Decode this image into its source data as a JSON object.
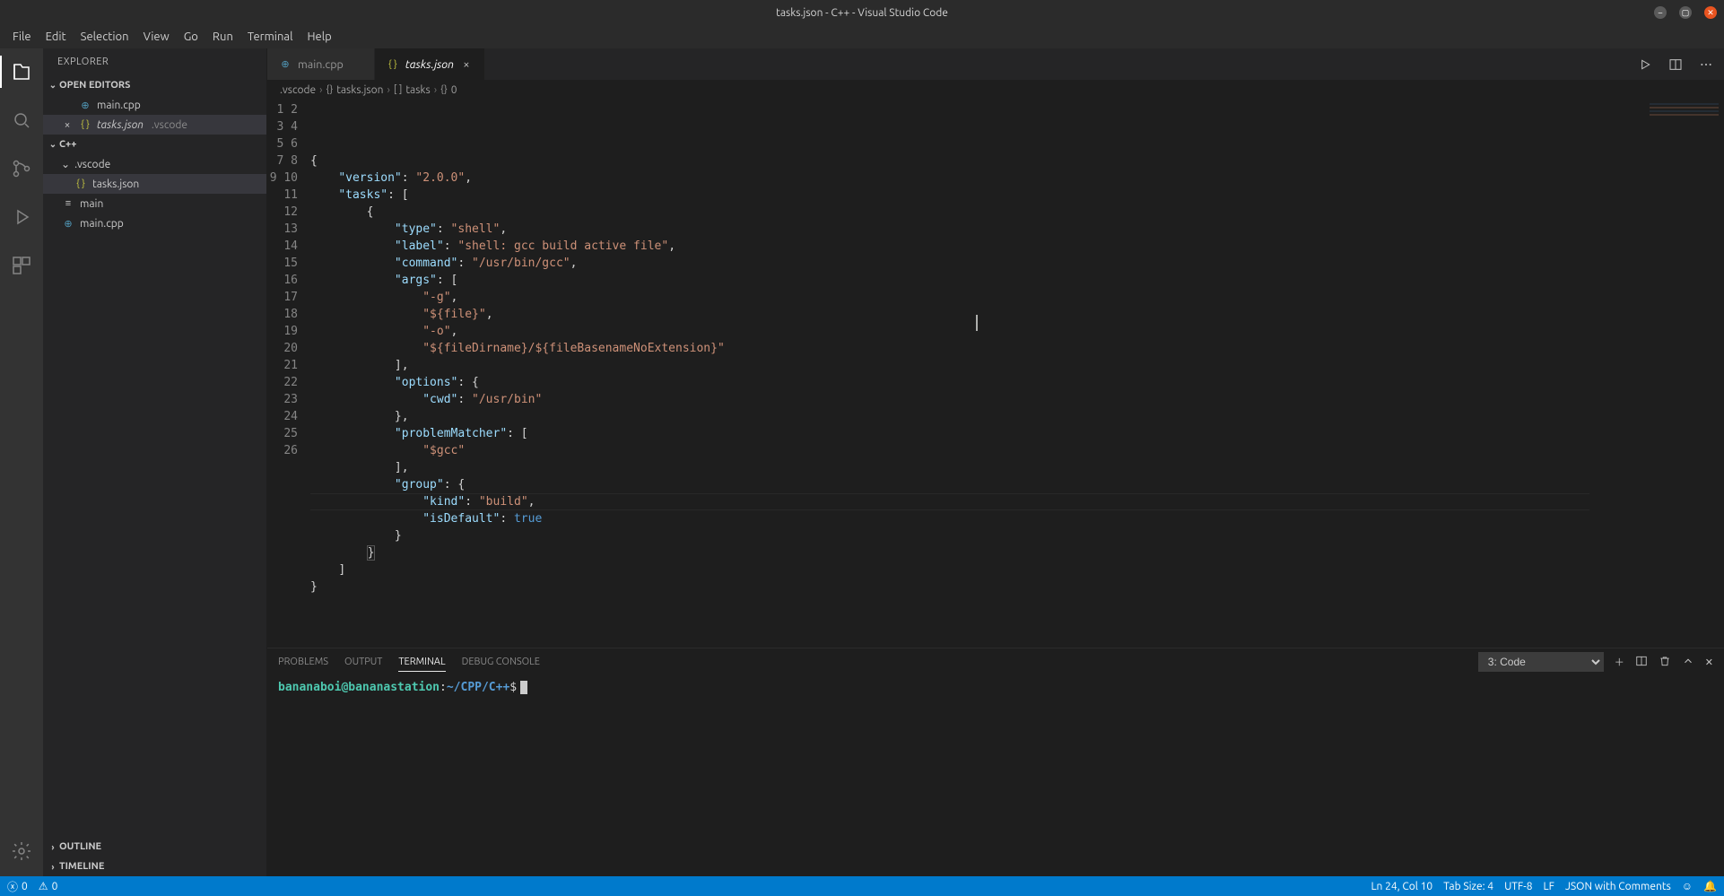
{
  "window": {
    "title": "tasks.json - C++ - Visual Studio Code"
  },
  "menu": {
    "items": [
      "File",
      "Edit",
      "Selection",
      "View",
      "Go",
      "Run",
      "Terminal",
      "Help"
    ]
  },
  "sidebar": {
    "title": "EXPLORER",
    "openEditors": {
      "label": "OPEN EDITORS",
      "items": [
        {
          "name": "main.cpp",
          "icon": "cpp",
          "dirty": false
        },
        {
          "name": "tasks.json",
          "icon": "json",
          "desc": ".vscode",
          "dirty": false,
          "active": true
        }
      ]
    },
    "workspace": {
      "label": "C++",
      "tree": [
        {
          "name": ".vscode",
          "type": "folder",
          "expanded": true,
          "indent": 1
        },
        {
          "name": "tasks.json",
          "type": "file",
          "icon": "json",
          "indent": 2,
          "selected": true
        },
        {
          "name": "main",
          "type": "file",
          "icon": "lines",
          "indent": 1
        },
        {
          "name": "main.cpp",
          "type": "file",
          "icon": "cpp",
          "indent": 1
        }
      ]
    },
    "outline": "OUTLINE",
    "timeline": "TIMELINE"
  },
  "tabs": [
    {
      "name": "main.cpp",
      "icon": "cpp",
      "active": false,
      "dirty": false
    },
    {
      "name": "tasks.json",
      "icon": "json",
      "active": true,
      "dirty": false
    }
  ],
  "breadcrumbs": [
    {
      "text": ".vscode"
    },
    {
      "icon": "{}",
      "text": "tasks.json"
    },
    {
      "icon": "[ ]",
      "text": "tasks"
    },
    {
      "icon": "{}",
      "text": "0"
    }
  ],
  "editor": {
    "lineCount": 26,
    "activeLine": 24,
    "cursorCol": 10,
    "lines": [
      [
        {
          "t": "punct",
          "v": "{"
        }
      ],
      [
        {
          "t": "pad",
          "v": "    "
        },
        {
          "t": "key",
          "v": "\"version\""
        },
        {
          "t": "punct",
          "v": ": "
        },
        {
          "t": "str",
          "v": "\"2.0.0\""
        },
        {
          "t": "punct",
          "v": ","
        }
      ],
      [
        {
          "t": "pad",
          "v": "    "
        },
        {
          "t": "key",
          "v": "\"tasks\""
        },
        {
          "t": "punct",
          "v": ": ["
        }
      ],
      [
        {
          "t": "pad",
          "v": "        "
        },
        {
          "t": "punct",
          "v": "{"
        }
      ],
      [
        {
          "t": "pad",
          "v": "            "
        },
        {
          "t": "key",
          "v": "\"type\""
        },
        {
          "t": "punct",
          "v": ": "
        },
        {
          "t": "str",
          "v": "\"shell\""
        },
        {
          "t": "punct",
          "v": ","
        }
      ],
      [
        {
          "t": "pad",
          "v": "            "
        },
        {
          "t": "key",
          "v": "\"label\""
        },
        {
          "t": "punct",
          "v": ": "
        },
        {
          "t": "str",
          "v": "\"shell: gcc build active file\""
        },
        {
          "t": "punct",
          "v": ","
        }
      ],
      [
        {
          "t": "pad",
          "v": "            "
        },
        {
          "t": "key",
          "v": "\"command\""
        },
        {
          "t": "punct",
          "v": ": "
        },
        {
          "t": "str",
          "v": "\"/usr/bin/gcc\""
        },
        {
          "t": "punct",
          "v": ","
        }
      ],
      [
        {
          "t": "pad",
          "v": "            "
        },
        {
          "t": "key",
          "v": "\"args\""
        },
        {
          "t": "punct",
          "v": ": ["
        }
      ],
      [
        {
          "t": "pad",
          "v": "                "
        },
        {
          "t": "str",
          "v": "\"-g\""
        },
        {
          "t": "punct",
          "v": ","
        }
      ],
      [
        {
          "t": "pad",
          "v": "                "
        },
        {
          "t": "str",
          "v": "\"${file}\""
        },
        {
          "t": "punct",
          "v": ","
        }
      ],
      [
        {
          "t": "pad",
          "v": "                "
        },
        {
          "t": "str",
          "v": "\"-o\""
        },
        {
          "t": "punct",
          "v": ","
        }
      ],
      [
        {
          "t": "pad",
          "v": "                "
        },
        {
          "t": "str",
          "v": "\"${fileDirname}/${fileBasenameNoExtension}\""
        }
      ],
      [
        {
          "t": "pad",
          "v": "            "
        },
        {
          "t": "punct",
          "v": "],"
        }
      ],
      [
        {
          "t": "pad",
          "v": "            "
        },
        {
          "t": "key",
          "v": "\"options\""
        },
        {
          "t": "punct",
          "v": ": {"
        }
      ],
      [
        {
          "t": "pad",
          "v": "                "
        },
        {
          "t": "key",
          "v": "\"cwd\""
        },
        {
          "t": "punct",
          "v": ": "
        },
        {
          "t": "str",
          "v": "\"/usr/bin\""
        }
      ],
      [
        {
          "t": "pad",
          "v": "            "
        },
        {
          "t": "punct",
          "v": "},"
        }
      ],
      [
        {
          "t": "pad",
          "v": "            "
        },
        {
          "t": "key",
          "v": "\"problemMatcher\""
        },
        {
          "t": "punct",
          "v": ": ["
        }
      ],
      [
        {
          "t": "pad",
          "v": "                "
        },
        {
          "t": "str",
          "v": "\"$gcc\""
        }
      ],
      [
        {
          "t": "pad",
          "v": "            "
        },
        {
          "t": "punct",
          "v": "],"
        }
      ],
      [
        {
          "t": "pad",
          "v": "            "
        },
        {
          "t": "key",
          "v": "\"group\""
        },
        {
          "t": "punct",
          "v": ": {"
        }
      ],
      [
        {
          "t": "pad",
          "v": "                "
        },
        {
          "t": "key",
          "v": "\"kind\""
        },
        {
          "t": "punct",
          "v": ": "
        },
        {
          "t": "str",
          "v": "\"build\""
        },
        {
          "t": "punct",
          "v": ","
        }
      ],
      [
        {
          "t": "pad",
          "v": "                "
        },
        {
          "t": "key",
          "v": "\"isDefault\""
        },
        {
          "t": "punct",
          "v": ": "
        },
        {
          "t": "bool",
          "v": "true"
        }
      ],
      [
        {
          "t": "pad",
          "v": "            "
        },
        {
          "t": "punct",
          "v": "}"
        }
      ],
      [
        {
          "t": "pad",
          "v": "        "
        },
        {
          "t": "punct",
          "v": "}",
          "match": true
        }
      ],
      [
        {
          "t": "pad",
          "v": "    "
        },
        {
          "t": "punct",
          "v": "]"
        }
      ],
      [
        {
          "t": "punct",
          "v": "}"
        }
      ]
    ]
  },
  "panel": {
    "tabs": [
      "PROBLEMS",
      "OUTPUT",
      "TERMINAL",
      "DEBUG CONSOLE"
    ],
    "activeTab": "TERMINAL",
    "terminalSelector": "3: Code",
    "prompt": {
      "userHost": "bananaboi@bananastation",
      "path": "~/CPP/C++",
      "symbol": "$"
    }
  },
  "status": {
    "errors": "0",
    "warnings": "0",
    "lncol": "Ln 24, Col 10",
    "tabsize": "Tab Size: 4",
    "encoding": "UTF-8",
    "eol": "LF",
    "language": "JSON with Comments"
  }
}
